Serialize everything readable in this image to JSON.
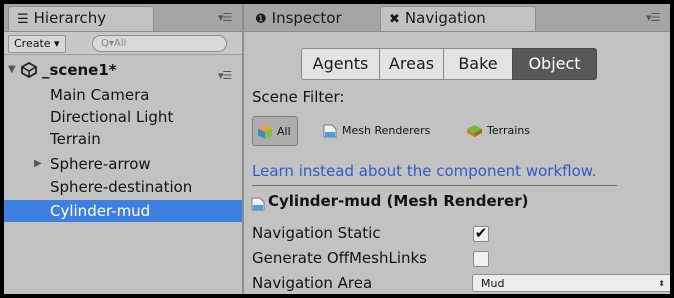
{
  "hierarchy": {
    "tab_label": "Hierarchy",
    "create_label": "Create ▾",
    "search_placeholder": "Q▾All",
    "scene_name": "_scene1*",
    "items": [
      {
        "label": "Main Camera"
      },
      {
        "label": "Directional Light"
      },
      {
        "label": "Terrain"
      },
      {
        "label": "Sphere-arrow"
      },
      {
        "label": "Sphere-destination"
      },
      {
        "label": "Cylinder-mud"
      }
    ],
    "selected_item": "Cylinder-mud"
  },
  "tabs": {
    "inspector_label": "Inspector",
    "navigation_label": "Navigation"
  },
  "navigation": {
    "segments": [
      "Agents",
      "Areas",
      "Bake",
      "Object"
    ],
    "active_segment": "Object",
    "scene_filter_label": "Scene Filter:",
    "filters": [
      {
        "label": "All",
        "active": true
      },
      {
        "label": "Mesh Renderers",
        "active": false
      },
      {
        "label": "Terrains",
        "active": false
      }
    ],
    "workflow_link": "Learn instead about the component workflow.",
    "object_title": "Cylinder-mud (Mesh Renderer)",
    "navigation_static_label": "Navigation Static",
    "navigation_static_checked": true,
    "offmesh_label": "Generate OffMeshLinks",
    "offmesh_checked": false,
    "area_label": "Navigation Area",
    "area_value": "Mud"
  },
  "colors": {
    "selection": "#3d80df",
    "link": "#2f5cc8",
    "panel_bg": "#c2c2c2",
    "active_segment": "#575757"
  }
}
